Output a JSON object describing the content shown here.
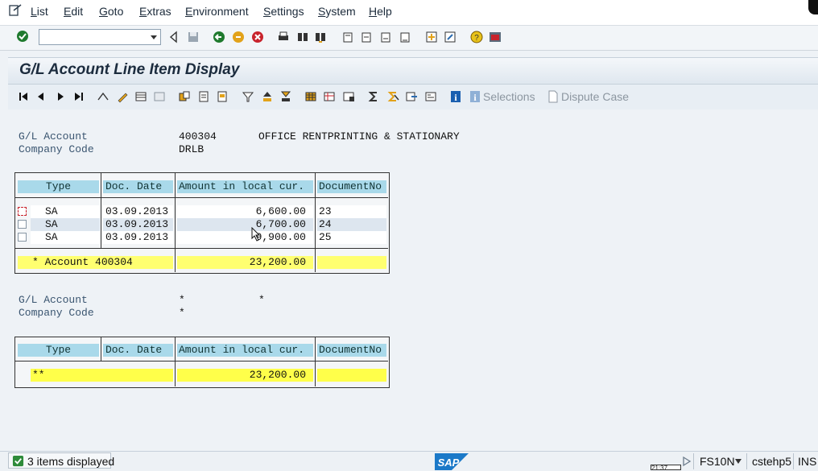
{
  "menu": {
    "items": [
      {
        "label": "List",
        "underline": "L",
        "rest": "ist"
      },
      {
        "label": "Edit",
        "underline": "E",
        "rest": "dit"
      },
      {
        "label": "Goto",
        "underline": "G",
        "rest": "oto"
      },
      {
        "label": "Extras",
        "underline": "E",
        "rest": "xtras"
      },
      {
        "label": "Environment",
        "underline": "E",
        "rest": "nvironment"
      },
      {
        "label": "Settings",
        "underline": "S",
        "rest": "ettings"
      },
      {
        "label": "System",
        "underline": "S",
        "rest": "ystem"
      },
      {
        "label": "Help",
        "underline": "H",
        "rest": "elp"
      }
    ]
  },
  "command_field": {
    "value": ""
  },
  "page_title": "G/L Account Line Item Display",
  "app_toolbar": {
    "selections_label": "Selections",
    "dispute_label": "Dispute Case"
  },
  "section1": {
    "gl_account_label": "G/L Account",
    "gl_account_value": "400304",
    "gl_account_desc": "OFFICE RENTPRINTING & STATIONARY",
    "company_code_label": "Company Code",
    "company_code_value": "DRLB"
  },
  "table_headers": {
    "type": "Type",
    "doc_date": "Doc. Date",
    "amount": "Amount in local cur.",
    "docno": "DocumentNo"
  },
  "table1": {
    "rows": [
      {
        "type": "SA",
        "doc_date": "03.09.2013",
        "amount": "6,600.00",
        "docno": "23"
      },
      {
        "type": "SA",
        "doc_date": "03.09.2013",
        "amount": "6,700.00",
        "docno": "24"
      },
      {
        "type": "SA",
        "doc_date": "03.09.2013",
        "amount": "9,900.00",
        "docno": "25"
      }
    ],
    "subtotal_label": "* Account 400304",
    "subtotal_amount": "23,200.00"
  },
  "section2": {
    "gl_account_label": "G/L Account",
    "gl_account_value": "*",
    "gl_account_desc": "*",
    "company_code_label": "Company Code",
    "company_code_value": "*"
  },
  "table2": {
    "total_label": "**",
    "total_amount": "23,200.00"
  },
  "statusbar": {
    "message": "3 items displayed",
    "time": "21:37",
    "tcode": "FS10N",
    "server": "cstehp5",
    "mode": "INS",
    "sap_logo_text": "SAP"
  },
  "colors": {
    "title_bg": "#dfe7ef",
    "col_header": "#a9d9ea",
    "subtotal": "#ffff70",
    "alt_row": "#dde6ef"
  }
}
